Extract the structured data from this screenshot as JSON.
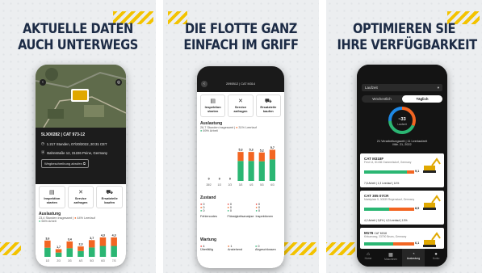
{
  "panels": [
    {
      "headline": [
        "AKTUELLE DATEN",
        "AUCH UNTERWEGS"
      ]
    },
    {
      "headline": [
        "DIE FLOTTE GANZ",
        "EINFACH IM GRIFF"
      ]
    },
    {
      "headline": [
        "OPTIMIEREN SIE",
        "IHRE VERFÜGBARKEIT"
      ]
    }
  ],
  "phone1": {
    "machine_id": "5LX00282 | CAT 973-12",
    "hours": "1.217 Stunden, 07/20/2022, 20:31 CET",
    "address": "Bahnstraße 12, 31226 Peine, Germany",
    "route_button": "Wegbeschreibung abrufen",
    "actions": [
      "Inspektion starten",
      "Service anfragen",
      "Ersatzteile kaufen"
    ],
    "usage_title": "Auslastung",
    "usage_sub": "23,4 Stunden insgesamt",
    "usage_legend_a": "44% Leerlauf",
    "usage_legend_b": "56% Arbeit",
    "chart_values": [
      "3,6",
      "1,7",
      "3,4",
      "2,3",
      "3,7",
      "4,3",
      "4,3"
    ],
    "chart_labels": [
      "1/3",
      "2/3",
      "3/3",
      "4/3",
      "5/3",
      "6/3",
      "7/3"
    ]
  },
  "phone2": {
    "serial": "2090B12 | CAT M314",
    "actions": [
      "Inspektion starten",
      "Service anfragen",
      "Ersatzteile kaufen"
    ],
    "usage_title": "Auslastung",
    "usage_sub": "26,7 Stunden insgesamt",
    "usage_legend_a": "31% Leerlauf",
    "usage_legend_b": "69% Arbeit",
    "chart_values": [
      "0",
      "0",
      "0",
      "5,3",
      "5,3",
      "5,2",
      "5,7"
    ],
    "chart_labels": [
      "28/2",
      "1/3",
      "2/3",
      "3/3",
      "4/3",
      "5/3",
      "6/3"
    ],
    "status_title": "Zustand",
    "status_cols": [
      {
        "rows": [
          "0",
          "0",
          "0"
        ],
        "label": "Fehlercodes"
      },
      {
        "rows": [
          "0",
          "0",
          "0"
        ],
        "label": "Flüssigkeitsanalyse"
      },
      {
        "rows": [
          "0",
          "0",
          "0"
        ],
        "label": "Inspektionen"
      }
    ],
    "maint_title": "Wartung",
    "maint_vals": [
      "4",
      "1",
      "0"
    ],
    "maint_labels": [
      "Überfällig",
      "Anstehend",
      "Abgeschlossen"
    ]
  },
  "phone3": {
    "dropdown": "Laufzeit",
    "seg": [
      "Wöchentlich",
      "Täglich"
    ],
    "donut_value": "~33",
    "donut_sub": "Laufzeit",
    "stat_line": "21 Verarbeitungszeit | 11 Leerlaufzeit",
    "stat_date": "Mär. 21, 2022",
    "machines": [
      {
        "name": "CAT M318F",
        "addr": "Fred 14, 81436 Gammelsdorf, Germany",
        "val": "9,1",
        "leg": "7,8 Arbeit | 1,3 Leerlauf | 14%"
      },
      {
        "name": "CAT 305 07CR",
        "addr": "Marktplatz 5, 30539 Regenstauf, Germany",
        "val": "8,5",
        "leg": "4,2 Arbeit | 3,8% | 4,3 Leerlauf | 13%"
      },
      {
        "name": "M176",
        "addr": "Kirkumweg, 33790 Bruns, Germany",
        "sub_name": "CAT M318",
        "val": "6,1",
        "leg": ""
      }
    ],
    "tabs": [
      "Home",
      "Maschinen",
      "Auslastung",
      "Konto"
    ]
  },
  "colors": {
    "work": "#2bb673",
    "idle": "#f26522",
    "navy": "#1c2b45",
    "accent": "#f3c300"
  }
}
